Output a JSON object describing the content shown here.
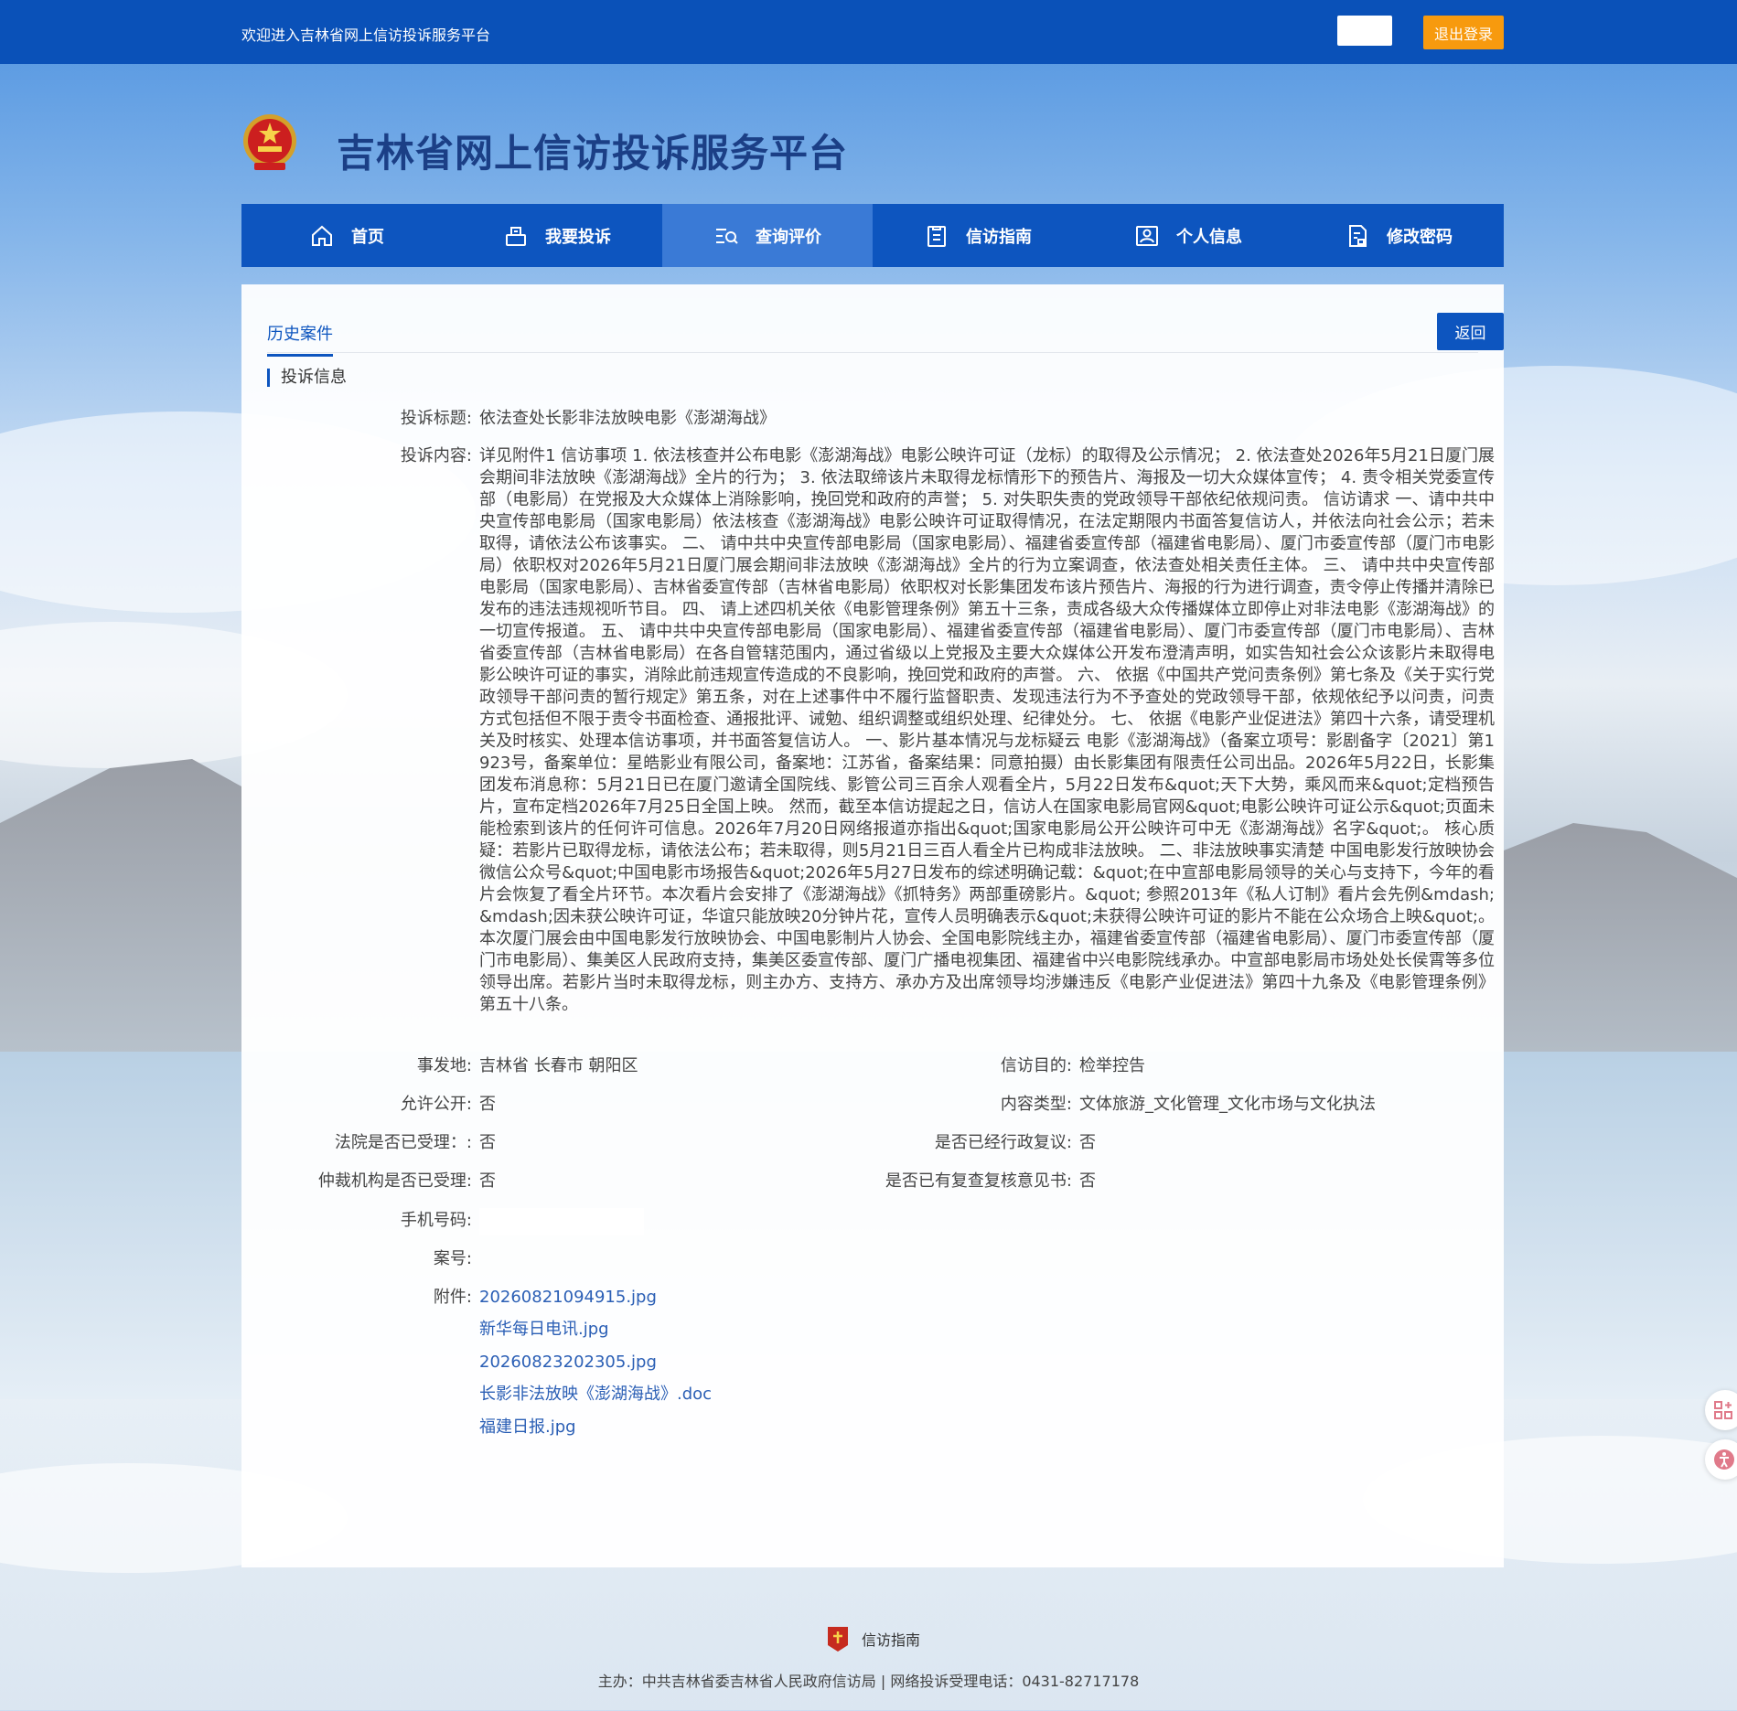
{
  "topbar": {
    "welcome": "欢迎进入吉林省网上信访投诉服务平台",
    "logout_label": "退出登录"
  },
  "header": {
    "title": "吉林省网上信访投诉服务平台"
  },
  "nav": {
    "items": [
      {
        "label": "首页",
        "icon": "home-icon",
        "active": false
      },
      {
        "label": "我要投诉",
        "icon": "complaint-icon",
        "active": false
      },
      {
        "label": "查询评价",
        "icon": "search-list-icon",
        "active": true
      },
      {
        "label": "信访指南",
        "icon": "guide-icon",
        "active": false
      },
      {
        "label": "个人信息",
        "icon": "user-card-icon",
        "active": false
      },
      {
        "label": "修改密码",
        "icon": "password-doc-icon",
        "active": false
      }
    ]
  },
  "main": {
    "tab_label": "历史案件",
    "back_label": "返回",
    "section_title": "投诉信息",
    "fields": {
      "title_label": "投诉标题:",
      "title_value": "依法查处长影非法放映电影《澎湖海战》",
      "content_label": "投诉内容:",
      "content_value": "详见附件1 信访事项 1. 依法核查并公布电影《澎湖海战》电影公映许可证（龙标）的取得及公示情况； 2. 依法查处2026年5月21日厦门展会期间非法放映《澎湖海战》全片的行为； 3. 依法取缔该片未取得龙标情形下的预告片、海报及一切大众媒体宣传； 4. 责令相关党委宣传部（电影局）在党报及大众媒体上消除影响，挽回党和政府的声誉； 5. 对失职失责的党政领导干部依纪依规问责。 信访请求 一、请中共中央宣传部电影局（国家电影局）依法核查《澎湖海战》电影公映许可证取得情况，在法定期限内书面答复信访人，并依法向社会公示；若未取得，请依法公布该事实。 二、 请中共中央宣传部电影局（国家电影局）、福建省委宣传部（福建省电影局）、厦门市委宣传部（厦门市电影局）依职权对2026年5月21日厦门展会期间非法放映《澎湖海战》全片的行为立案调查，依法查处相关责任主体。 三、 请中共中央宣传部电影局（国家电影局）、吉林省委宣传部（吉林省电影局）依职权对长影集团发布该片预告片、海报的行为进行调查，责令停止传播并清除已发布的违法违规视听节目。 四、 请上述四机关依《电影管理条例》第五十三条，责成各级大众传播媒体立即停止对非法电影《澎湖海战》的一切宣传报道。 五、 请中共中央宣传部电影局（国家电影局）、福建省委宣传部（福建省电影局）、厦门市委宣传部（厦门市电影局）、吉林省委宣传部（吉林省电影局）在各自管辖范围内，通过省级以上党报及主要大众媒体公开发布澄清声明，如实告知社会公众该影片未取得电影公映许可证的事实，消除此前违规宣传造成的不良影响，挽回党和政府的声誉。 六、 依据《中国共产党问责条例》第七条及《关于实行党政领导干部问责的暂行规定》第五条，对在上述事件中不履行监督职责、发现违法行为不予查处的党政领导干部，依规依纪予以问责，问责方式包括但不限于责令书面检查、通报批评、诫勉、组织调整或组织处理、纪律处分。 七、 依据《电影产业促进法》第四十六条，请受理机关及时核实、处理本信访事项，并书面答复信访人。 一、影片基本情况与龙标疑云 电影《澎湖海战》（备案立项号：影剧备字〔2021〕第1923号，备案单位：星皓影业有限公司，备案地：江苏省，备案结果：同意拍摄）由长影集团有限责任公司出品。2026年5月22日，长影集团发布消息称：5月21日已在厦门邀请全国院线、影管公司三百余人观看全片，5月22日发布&quot;天下大势，乘风而来&quot;定档预告片，宣布定档2026年7月25日全国上映。 然而，截至本信访提起之日，信访人在国家电影局官网&quot;电影公映许可证公示&quot;页面未能检索到该片的任何许可信息。2026年7月20日网络报道亦指出&quot;国家电影局公开公映许可中无《澎湖海战》名字&quot;。 核心质疑：若影片已取得龙标，请依法公布；若未取得，则5月21日三百人看全片已构成非法放映。 二、非法放映事实清楚 中国电影发行放映协会微信公众号&quot;中国电影市场报告&quot;2026年5月27日发布的综述明确记载：&quot;在中宣部电影局领导的关心与支持下，今年的看片会恢复了看全片环节。本次看片会安排了《澎湖海战》《抓特务》两部重磅影片。&quot; 参照2013年《私人订制》看片会先例&mdash;&mdash;因未获公映许可证，华谊只能放映20分钟片花，宣传人员明确表示&quot;未获得公映许可证的影片不能在公众场合上映&quot;。 本次厦门展会由中国电影发行放映协会、中国电影制片人协会、全国电影院线主办，福建省委宣传部（福建省电影局）、厦门市委宣传部（厦门市电影局）、集美区人民政府支持，集美区委宣传部、厦门广播电视集团、福建省中兴电影院线承办。中宣部电影局市场处处长侯霄等多位领导出席。若影片当时未取得龙标，则主办方、支持方、承办方及出席领导均涉嫌违反《电影产业促进法》第四十九条及《电影管理条例》第五十八条。",
      "location_label": "事发地:",
      "location_value": "吉林省 长春市 朝阳区",
      "purpose_label": "信访目的:",
      "purpose_value": "检举控告",
      "public_label": "允许公开:",
      "public_value": "否",
      "content_type_label": "内容类型:",
      "content_type_value": "文体旅游_文化管理_文化市场与文化执法",
      "court_label": "法院是否已受理：:",
      "court_value": "否",
      "admin_review_label": "是否已经行政复议:",
      "admin_review_value": "否",
      "arbitration_label": "仲裁机构是否已受理:",
      "arbitration_value": "否",
      "recheck_label": "是否已有复查复核意见书:",
      "recheck_value": "否",
      "phone_label": "手机号码:",
      "phone_value": "",
      "case_no_label": "案号:",
      "case_no_value": "",
      "attachments_label": "附件:",
      "attachments": [
        "20260821094915.jpg",
        "新华每日电讯.jpg",
        "20260823202305.jpg",
        "长影非法放映《澎湖海战》.doc",
        "福建日报.jpg"
      ]
    }
  },
  "footer": {
    "guide_label": "信访指南",
    "info": "主办：中共吉林省委吉林省人民政府信访局 | 网络投诉受理电话：0431-82717178"
  },
  "colors": {
    "primary": "#0d55bf",
    "topbar": "#0a51b8",
    "logout": "#f79a0e",
    "link": "#2b5fb5"
  }
}
